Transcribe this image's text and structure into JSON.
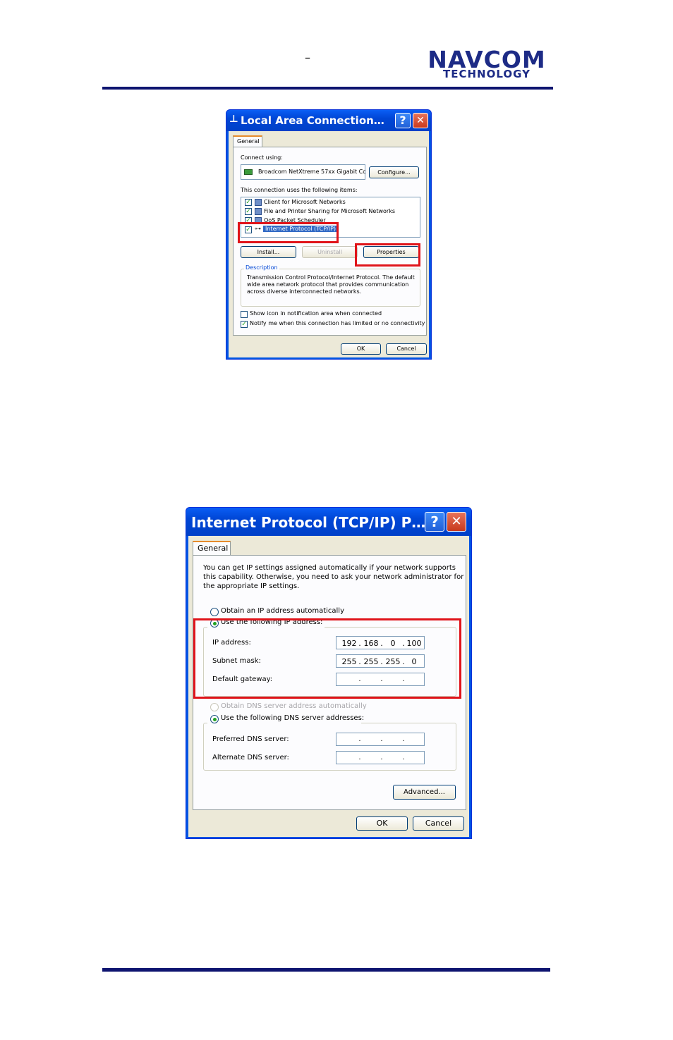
{
  "header": {
    "dash": "–",
    "logo_line1": "NAVCOM",
    "logo_line2": "TECHNOLOGY"
  },
  "lac": {
    "title": "Local Area Connection…",
    "help": "?",
    "close": "✕",
    "tab": "General",
    "connect_using_label": "Connect using:",
    "adapter": "Broadcom NetXtreme 57xx Gigabit Cc",
    "configure": "Configure...",
    "items_label": "This connection uses the following items:",
    "items": [
      {
        "label": "Client for Microsoft Networks",
        "checked": true
      },
      {
        "label": "File and Printer Sharing for Microsoft Networks",
        "checked": true
      },
      {
        "label": "QoS Packet Scheduler",
        "checked": true
      },
      {
        "label": "Internet Protocol (TCP/IP)",
        "checked": true
      }
    ],
    "install": "Install...",
    "uninstall": "Uninstall",
    "properties": "Properties",
    "description_label": "Description",
    "description": "Transmission Control Protocol/Internet Protocol. The default wide area network protocol that provides communication across diverse interconnected networks.",
    "show_icon": "Show icon in notification area when connected",
    "notify": "Notify me when this connection has limited or no connectivity",
    "ok": "OK",
    "cancel": "Cancel"
  },
  "tcp": {
    "title": "Internet Protocol (TCP/IP) P…",
    "help": "?",
    "close": "✕",
    "tab": "General",
    "intro": [
      "You can get IP settings assigned automatically if your network supports",
      "this capability. Otherwise, you need to ask your network administrator for",
      "the appropriate IP settings."
    ],
    "obtain_ip": "Obtain an IP address automatically",
    "use_ip": "Use the following IP address:",
    "ip_label": "IP address:",
    "ip": [
      "192",
      "168",
      "0",
      "100"
    ],
    "subnet_label": "Subnet mask:",
    "subnet": [
      "255",
      "255",
      "255",
      "0"
    ],
    "gateway_label": "Default gateway:",
    "obtain_dns": "Obtain DNS server address automatically",
    "use_dns": "Use the following DNS server addresses:",
    "pref_dns_label": "Preferred DNS server:",
    "alt_dns_label": "Alternate DNS server:",
    "advanced": "Advanced...",
    "ok": "OK",
    "cancel": "Cancel"
  }
}
